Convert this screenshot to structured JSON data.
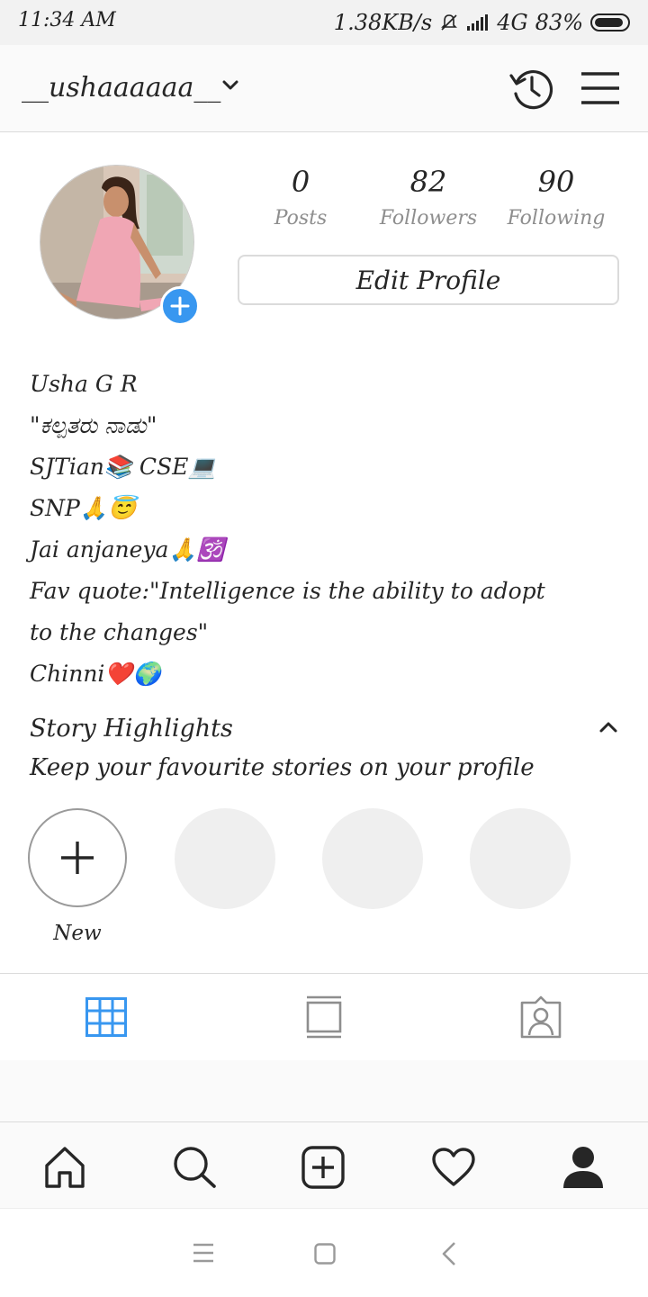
{
  "status_bar": {
    "time": "11:34 AM",
    "speed": "1.38KB/s",
    "network": "4G",
    "battery": "83%"
  },
  "header": {
    "username": "__ushaaaaaa__",
    "icons": [
      "chevron-down-icon",
      "history-icon",
      "menu-icon"
    ]
  },
  "profile": {
    "stats": [
      {
        "value": "0",
        "label": "Posts"
      },
      {
        "value": "82",
        "label": "Followers"
      },
      {
        "value": "90",
        "label": "Following"
      }
    ],
    "edit_label": "Edit Profile",
    "bio": [
      "Usha G R",
      "\"ಕಲ್ಪತರು ನಾಡು\"",
      "SJTian📚 CSE💻",
      "SNP🙏😇",
      "Jai anjaneya🙏🕉️",
      "Fav quote:\"Intelligence is the ability to adopt",
      "to the changes\"",
      "Chinni❤️🌍"
    ]
  },
  "highlights": {
    "title": "Story Highlights",
    "subtitle": "Keep your favourite stories on your profile",
    "new_label": "New"
  },
  "tabs": [
    "grid-icon",
    "feed-icon",
    "tagged-icon"
  ],
  "bottom_nav": [
    "home-icon",
    "search-icon",
    "add-icon",
    "heart-icon",
    "profile-icon"
  ],
  "colors": {
    "accent": "#3897f0",
    "text": "#262626",
    "muted": "#8e8e8e",
    "border": "#dbdbdb"
  }
}
